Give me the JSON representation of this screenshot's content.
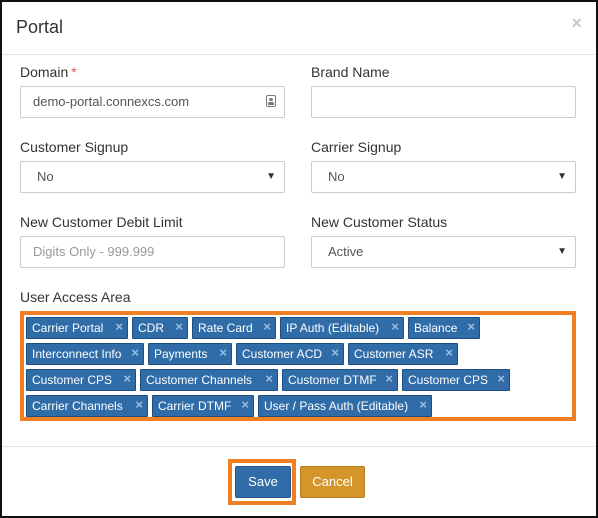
{
  "modal": {
    "title": "Portal",
    "close_symbol": "×"
  },
  "form": {
    "domain": {
      "label": "Domain",
      "required_mark": "*",
      "value": "demo-portal.connexcs.com",
      "icon": "contact-card-icon"
    },
    "brand_name": {
      "label": "Brand Name",
      "value": ""
    },
    "customer_signup": {
      "label": "Customer Signup",
      "value": "No"
    },
    "carrier_signup": {
      "label": "Carrier Signup",
      "value": "No"
    },
    "new_customer_debit_limit": {
      "label": "New Customer Debit Limit",
      "placeholder": "Digits Only - 999.999"
    },
    "new_customer_status": {
      "label": "New Customer Status",
      "value": "Active"
    },
    "user_access_area": {
      "label": "User Access Area",
      "tags": [
        "Carrier Portal",
        "CDR",
        "Rate Card",
        "IP Auth (Editable)",
        "Balance",
        "Interconnect Info",
        "Payments",
        "Customer ACD",
        "Customer ASR",
        "Customer CPS",
        "Customer Channels",
        "Customer DTMF",
        "Customer CPS",
        "Carrier Channels",
        "Carrier DTMF",
        "User / Pass Auth (Editable)"
      ],
      "tag_remove_symbol": "×"
    }
  },
  "footer": {
    "save_label": "Save",
    "cancel_label": "Cancel"
  },
  "colors": {
    "tag_bg": "#2f6ca8",
    "highlight": "#f07f24",
    "save_button": "#2f6ca8",
    "cancel_button": "#d4952a",
    "required": "#d9534f"
  }
}
